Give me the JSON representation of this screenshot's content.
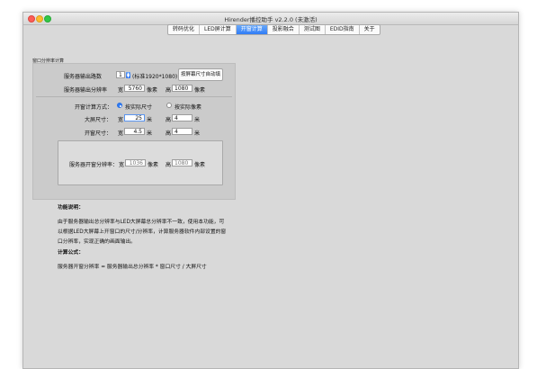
{
  "window": {
    "title": "Hirender播控助手 v2.2.0 (未激活)"
  },
  "tabs": [
    {
      "label": "转码优化"
    },
    {
      "label": "LED屏计算"
    },
    {
      "label": "开窗计算",
      "active": true
    },
    {
      "label": "投影融合"
    },
    {
      "label": "测试图"
    },
    {
      "label": "EDID指南"
    },
    {
      "label": "关于"
    }
  ],
  "panel": {
    "group_label": "窗口分辨率计算",
    "output_count_label": "服务器输出路数",
    "output_count_value": "1",
    "output_standard": "(标准1920*1080)",
    "fill_button": "按屏幕尺寸自动填",
    "output_res_label": "服务器输出分辨率",
    "width_label": "宽",
    "height_label": "高",
    "pixel_unit": "像素",
    "meter_unit": "米",
    "output_width": "5760",
    "output_height": "1080",
    "method_label": "开窗计算方式：",
    "method_actual_size": "按实际尺寸",
    "method_actual_pixel": "按实际像素",
    "screen_size_label": "大屏尺寸：",
    "screen_width": "25",
    "screen_height": "4",
    "window_size_label": "开窗尺寸：",
    "window_width": "4.5",
    "window_height": "4",
    "result_label": "服务器开窗分辨率：",
    "result_width": "1036",
    "result_height": "1080"
  },
  "description": {
    "heading": "功能说明：",
    "line1": "由于服务器输出总分辨率与LED大屏幕总分辨率不一致，使用本功能，可",
    "line2": "以根据LED大屏幕上开窗口的尺寸/分辨率，计算服务器软件内部设置的窗",
    "line3": "口分辨率，实现正确的画面输出。",
    "formula_heading": "计算公式：",
    "formula": "服务器开窗分辨率 = 服务器输出总分辨率 * 窗口尺寸 / 大屏尺寸"
  }
}
